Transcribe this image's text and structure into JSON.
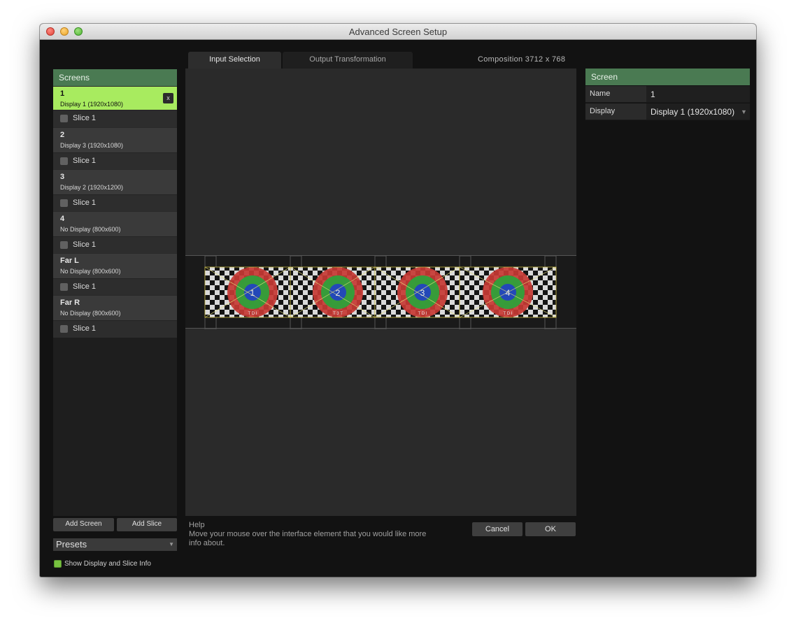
{
  "window": {
    "title": "Advanced Screen Setup"
  },
  "screens_panel": {
    "header": "Screens",
    "remove_label": "x",
    "screens": [
      {
        "name": "1",
        "display": "Display 1 (1920x1080)",
        "selected": true,
        "slice": "Slice 1"
      },
      {
        "name": "2",
        "display": "Display 3 (1920x1080)",
        "selected": false,
        "slice": "Slice 1"
      },
      {
        "name": "3",
        "display": "Display 2 (1920x1200)",
        "selected": false,
        "slice": "Slice 1"
      },
      {
        "name": "4",
        "display": "No Display (800x600)",
        "selected": false,
        "slice": "Slice 1"
      },
      {
        "name": "Far L",
        "display": "No Display (800x600)",
        "selected": false,
        "slice": "Slice 1"
      },
      {
        "name": "Far R",
        "display": "No Display (800x600)",
        "selected": false,
        "slice": "Slice 1"
      }
    ],
    "add_screen_label": "Add Screen",
    "add_slice_label": "Add Slice",
    "presets_label": "Presets",
    "show_info_label": "Show Display and Slice Info",
    "show_info_checked": true
  },
  "tabs": [
    {
      "label": "Input Selection",
      "active": true
    },
    {
      "label": "Output Transformation",
      "active": false
    }
  ],
  "composition": "Composition 3712 x 768",
  "test_screens": [
    {
      "number": "1",
      "caption": "T D I"
    },
    {
      "number": "2",
      "caption": "T 3 T"
    },
    {
      "number": "3",
      "caption": "T D I"
    },
    {
      "number": "4",
      "caption": "T D I"
    }
  ],
  "help": {
    "title": "Help",
    "text": "Move your mouse over the interface element that you would like more info about."
  },
  "footer": {
    "cancel_label": "Cancel",
    "ok_label": "OK"
  },
  "screen_panel": {
    "header": "Screen",
    "name_label": "Name",
    "name_value": "1",
    "display_label": "Display",
    "display_value": "Display 1 (1920x1080)"
  },
  "colors": {
    "panel_header": "#4a7a52",
    "selected_row": "#a8eb5f",
    "checkbox_on": "#77c23f"
  }
}
